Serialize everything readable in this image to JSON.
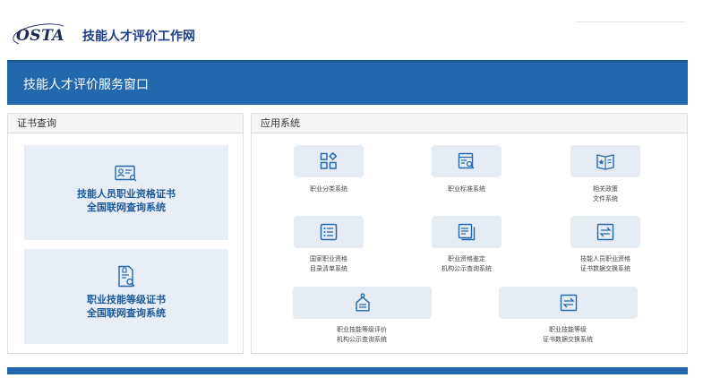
{
  "header": {
    "logo_mark": "OSTA",
    "site_name": "技能人才评价工作网"
  },
  "banner": {
    "title": "技能人才评价服务窗口"
  },
  "certificate_panel": {
    "title": "证书查询",
    "cards": [
      {
        "line1": "技能人员职业资格证书",
        "line2": "全国联网查询系统",
        "icon": "certificate-search-icon"
      },
      {
        "line1": "职业技能等级证书",
        "line2": "全国联网查询系统",
        "icon": "document-search-icon"
      }
    ]
  },
  "apps_panel": {
    "title": "应用系统",
    "apps": [
      {
        "line1": "职业分类系统",
        "line2": "",
        "icon": "grid-diamond-icon"
      },
      {
        "line1": "职业标准系统",
        "line2": "",
        "icon": "document-search-icon"
      },
      {
        "line1": "相关政策",
        "line2": "文件系统",
        "icon": "star-book-icon"
      },
      {
        "line1": "国家职业资格",
        "line2": "目录清单系统",
        "icon": "list-icon"
      },
      {
        "line1": "职业资格鉴定",
        "line2": "机构公示查询系统",
        "icon": "document-stack-icon"
      },
      {
        "line1": "技能人员职业资格",
        "line2": "证书数据交换系统",
        "icon": "exchange-icon"
      },
      {
        "line1": "职业技能等级评价",
        "line2": "机构公示查询系统",
        "icon": "tag-bag-icon"
      },
      {
        "line1": "职业技能等级",
        "line2": "证书数据交换系统",
        "icon": "exchange-icon"
      }
    ]
  },
  "colors": {
    "brand_blue": "#2268ad",
    "icon_blue": "#2268ad",
    "tile_bg": "#e6ecf4"
  }
}
